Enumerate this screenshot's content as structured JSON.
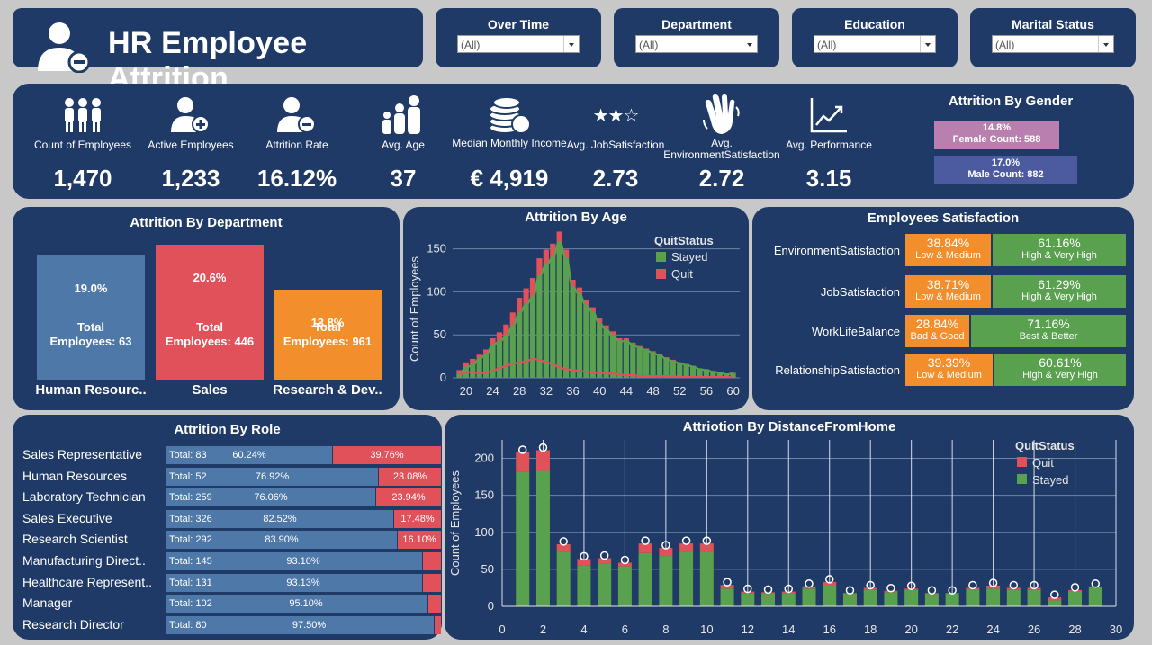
{
  "header": {
    "title": "HR Employee Attrition"
  },
  "filters": [
    {
      "label": "Over Time",
      "value": "(All)"
    },
    {
      "label": "Department",
      "value": "(All)"
    },
    {
      "label": "Education",
      "value": "(All)"
    },
    {
      "label": "Marital Status",
      "value": "(All)"
    }
  ],
  "kpis": [
    {
      "label": "Count of Employees",
      "value": "1,470",
      "icon": "group-people-icon"
    },
    {
      "label": "Active Employees",
      "value": "1,233",
      "icon": "user-add-icon"
    },
    {
      "label": "Attrition Rate",
      "value": "16.12%",
      "icon": "user-remove-icon"
    },
    {
      "label": "Avg. Age",
      "value": "37",
      "icon": "family-icon"
    },
    {
      "label": "Median Monthly Income",
      "value": "€ 4,919",
      "icon": "coins-icon"
    },
    {
      "label": "Avg. JobSatisfaction",
      "value": "2.73",
      "icon": "stars-icon"
    },
    {
      "label": "Avg. EnvironmentSatisfaction",
      "value": "2.72",
      "icon": "waving-hand-icon"
    },
    {
      "label": "Avg. Performance",
      "value": "3.15",
      "icon": "trend-chart-icon"
    }
  ],
  "gender": {
    "title": "Attrition By Gender",
    "female": {
      "pct": "14.8%",
      "count": "Female Count: 588",
      "color": "#b97fae"
    },
    "male": {
      "pct": "17.0%",
      "count": "Male Count: 882",
      "color": "#4c5aa0"
    }
  },
  "department": {
    "title": "Attrition By Department",
    "items": [
      {
        "name": "Human Resourc..",
        "pct": "19.0%",
        "total_label": "Total",
        "total_value": "Employees: 63",
        "color": "#4e78a8"
      },
      {
        "name": "Sales",
        "pct": "20.6%",
        "total_label": "Total",
        "total_value": "Employees: 446",
        "color": "#e0515a"
      },
      {
        "name": "Research & Dev..",
        "pct": "13.8%",
        "total_label": "Total",
        "total_value": "Employees: 961",
        "color": "#f28e2b"
      }
    ]
  },
  "satisfaction": {
    "title": "Employees Satisfaction",
    "rows": [
      {
        "label": "EnvironmentSatisfaction",
        "low_pct": "38.84%",
        "low_label": "Low & Medium",
        "high_pct": "61.16%",
        "high_label": "High & Very High",
        "low_share": 38.84
      },
      {
        "label": "JobSatisfaction",
        "low_pct": "38.71%",
        "low_label": "Low & Medium",
        "high_pct": "61.29%",
        "high_label": "High & Very High",
        "low_share": 38.71
      },
      {
        "label": "WorkLifeBalance",
        "low_pct": "28.84%",
        "low_label": "Bad & Good",
        "high_pct": "71.16%",
        "high_label": "Best & Better",
        "low_share": 28.84
      },
      {
        "label": "RelationshipSatisfaction",
        "low_pct": "39.39%",
        "low_label": "Low & Medium",
        "high_pct": "60.61%",
        "high_label": "High & Very High",
        "low_share": 39.39
      }
    ],
    "colors": {
      "low": "#f28e2b",
      "high": "#59a14f"
    }
  },
  "roles": {
    "title": "Attrition By Role",
    "rows": [
      {
        "role": "Sales Representative",
        "total": "Total: 83",
        "stay_pct": "60.24%",
        "quit_pct": "39.76%",
        "stay_share": 60.24
      },
      {
        "role": "Human Resources",
        "total": "Total: 52",
        "stay_pct": "76.92%",
        "quit_pct": "23.08%",
        "stay_share": 76.92
      },
      {
        "role": "Laboratory Technician",
        "total": "Total: 259",
        "stay_pct": "76.06%",
        "quit_pct": "23.94%",
        "stay_share": 76.06
      },
      {
        "role": "Sales Executive",
        "total": "Total: 326",
        "stay_pct": "82.52%",
        "quit_pct": "17.48%",
        "stay_share": 82.52
      },
      {
        "role": "Research Scientist",
        "total": "Total: 292",
        "stay_pct": "83.90%",
        "quit_pct": "16.10%",
        "stay_share": 83.9
      },
      {
        "role": "Manufacturing Direct..",
        "total": "Total: 145",
        "stay_pct": "93.10%",
        "quit_pct": "",
        "stay_share": 93.1
      },
      {
        "role": "Healthcare Represent..",
        "total": "Total: 131",
        "stay_pct": "93.13%",
        "quit_pct": "",
        "stay_share": 93.13
      },
      {
        "role": "Manager",
        "total": "Total: 102",
        "stay_pct": "95.10%",
        "quit_pct": "",
        "stay_share": 95.1
      },
      {
        "role": "Research Director",
        "total": "Total: 80",
        "stay_pct": "97.50%",
        "quit_pct": "",
        "stay_share": 97.5
      }
    ],
    "colors": {
      "stay": "#4e78a8",
      "quit": "#e0515a"
    }
  },
  "chart_data": [
    {
      "id": "age",
      "type": "bar",
      "title": "Attrition By Age",
      "ylabel": "Count of Employees",
      "legend_title": "QuitStatus",
      "legend_placement": "top-right",
      "x": [
        19,
        20,
        21,
        22,
        23,
        24,
        25,
        26,
        27,
        28,
        29,
        30,
        31,
        32,
        33,
        34,
        35,
        36,
        37,
        38,
        39,
        40,
        41,
        42,
        43,
        44,
        45,
        46,
        47,
        48,
        49,
        50,
        51,
        52,
        53,
        54,
        55,
        56,
        57,
        58,
        59,
        60
      ],
      "series": [
        {
          "name": "Stayed",
          "color": "#59a14f",
          "values": [
            5,
            12,
            15,
            22,
            27,
            38,
            42,
            48,
            60,
            75,
            85,
            94,
            118,
            131,
            140,
            158,
            139,
            105,
            97,
            84,
            76,
            63,
            56,
            49,
            42,
            43,
            38,
            35,
            32,
            29,
            26,
            22,
            19,
            17,
            15,
            13,
            10,
            9,
            7,
            6,
            4,
            5
          ]
        },
        {
          "name": "Quit",
          "color": "#e0515a",
          "values": [
            4,
            6,
            7,
            5,
            6,
            8,
            11,
            14,
            16,
            18,
            19,
            22,
            21,
            18,
            16,
            12,
            10,
            9,
            8,
            7,
            6,
            6,
            5,
            5,
            4,
            3,
            3,
            2,
            2,
            2,
            2,
            2,
            2,
            1,
            1,
            1,
            1,
            1,
            1,
            1,
            1,
            1
          ]
        }
      ],
      "xticks": [
        20,
        24,
        28,
        32,
        36,
        40,
        44,
        48,
        52,
        56,
        60
      ],
      "yticks": [
        0,
        50,
        100,
        150
      ],
      "ylim": [
        0,
        160
      ],
      "xlim": [
        18,
        61
      ]
    },
    {
      "id": "distance",
      "type": "bar",
      "title": "Attriotion By DistanceFromHome",
      "ylabel": "Count of Employees",
      "legend_title": "QuitStatus",
      "legend_placement": "top-right",
      "x": [
        1,
        2,
        3,
        4,
        5,
        6,
        7,
        8,
        9,
        10,
        11,
        12,
        13,
        14,
        15,
        16,
        17,
        18,
        19,
        20,
        21,
        22,
        23,
        24,
        25,
        26,
        27,
        28,
        29
      ],
      "series": [
        {
          "name": "Quit",
          "color": "#e0515a",
          "values": [
            26,
            28,
            10,
            9,
            7,
            5,
            13,
            11,
            12,
            11,
            5,
            2,
            2,
            2,
            3,
            5,
            1,
            3,
            2,
            2,
            1,
            1,
            2,
            4,
            3,
            3,
            4,
            2,
            1
          ]
        },
        {
          "name": "Stayed",
          "color": "#59a14f",
          "values": [
            182,
            183,
            74,
            55,
            58,
            54,
            72,
            68,
            73,
            74,
            24,
            18,
            17,
            18,
            24,
            28,
            17,
            22,
            19,
            22,
            17,
            17,
            23,
            24,
            22,
            22,
            8,
            20,
            26
          ]
        }
      ],
      "xticks": [
        0,
        2,
        4,
        6,
        8,
        10,
        12,
        14,
        16,
        18,
        20,
        22,
        24,
        26,
        28,
        30
      ],
      "yticks": [
        0,
        50,
        100,
        150,
        200
      ],
      "ylim": [
        0,
        225
      ],
      "xlim": [
        0,
        30
      ]
    }
  ]
}
